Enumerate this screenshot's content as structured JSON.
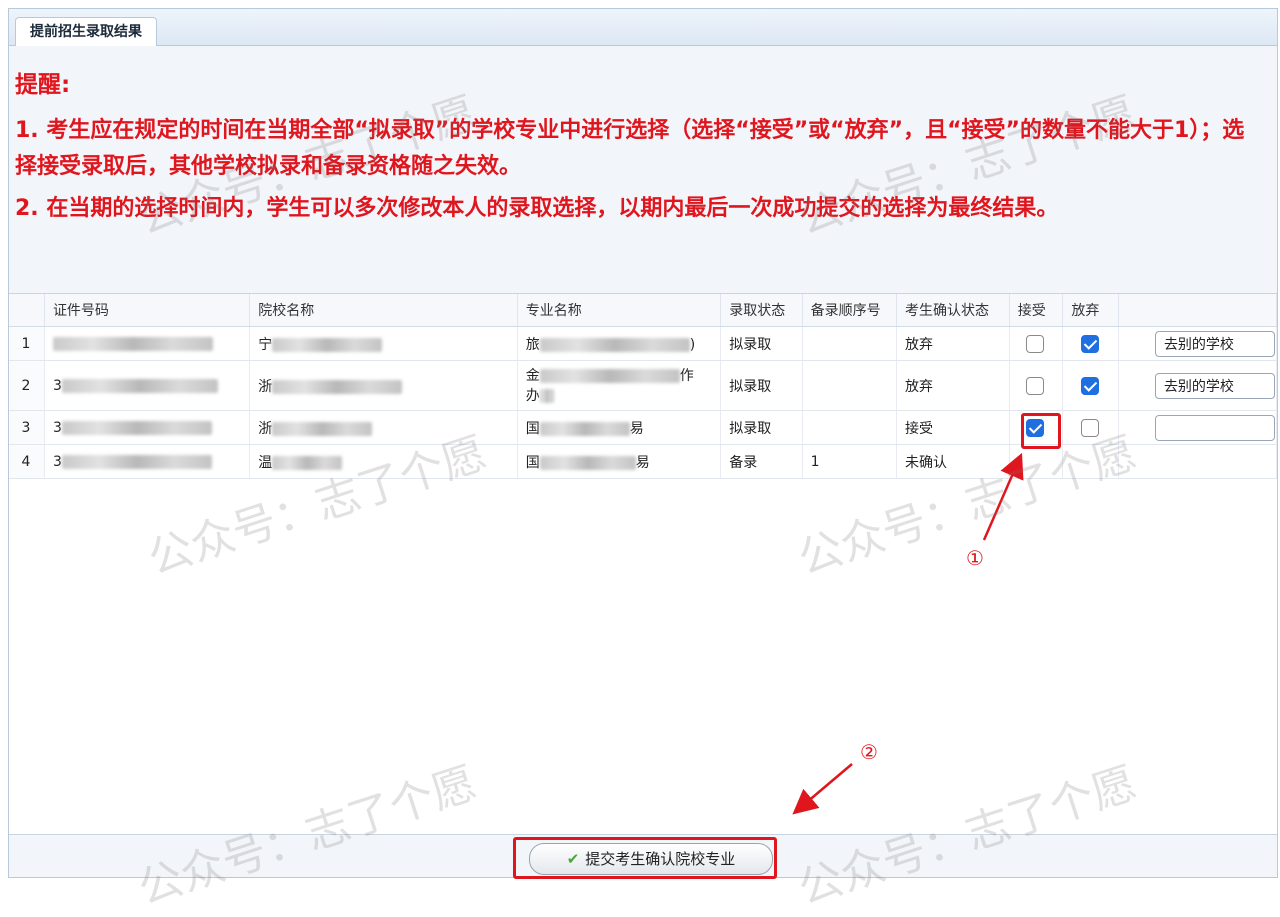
{
  "tab": {
    "label": "提前招生录取结果"
  },
  "notice": {
    "title": "提醒:",
    "line1": "1. 考生应在规定的时间在当期全部“拟录取”的学校专业中进行选择（选择“接受”或“放弃”，且“接受”的数量不能大于1）；选择接受录取后，其他学校拟录和备录资格随之失效。",
    "line2": "2. 在当期的选择时间内，学生可以多次修改本人的录取选择，以期内最后一次成功提交的选择为最终结果。"
  },
  "grid": {
    "headers": [
      "证件号码",
      "院校名称",
      "专业名称",
      "录取状态",
      "备录顺序号",
      "考生确认状态",
      "接受",
      "放弃"
    ],
    "rows": [
      {
        "num": "1",
        "id_prefix": "",
        "school": "宁",
        "major": "旅",
        "major_suffix": ")",
        "status": "拟录取",
        "order": "",
        "confirm": "放弃",
        "accept": false,
        "reject": true,
        "reason": "去别的学校"
      },
      {
        "num": "2",
        "id_prefix": "3",
        "school": "浙",
        "major": "金",
        "major_suffix": "作",
        "major_line2": "办",
        "status": "拟录取",
        "order": "",
        "confirm": "放弃",
        "accept": false,
        "reject": true,
        "reason": "去别的学校"
      },
      {
        "num": "3",
        "id_prefix": "3",
        "school": "浙",
        "major": "国",
        "major_suffix": "易",
        "status": "拟录取",
        "order": "",
        "confirm": "接受",
        "accept": true,
        "reject": false,
        "reason": ""
      },
      {
        "num": "4",
        "id_prefix": "3",
        "school": "温",
        "major": "国",
        "major_suffix": "易",
        "status": "备录",
        "order": "1",
        "confirm": "未确认",
        "accept": false,
        "reject": false,
        "reason": ""
      }
    ]
  },
  "submit": {
    "label": "提交考生确认院校专业"
  },
  "annotations": {
    "one": "①",
    "two": "②"
  },
  "watermark": "公众号：志了个愿",
  "colors": {
    "alert": "#e0161e",
    "checkbox": "#1f6fe0"
  }
}
